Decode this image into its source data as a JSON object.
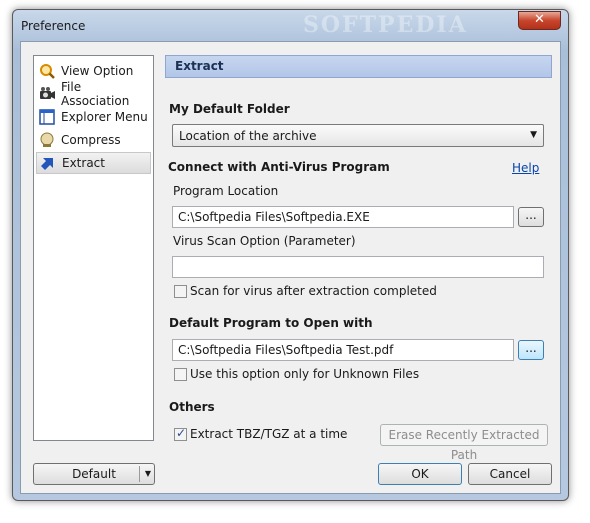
{
  "window": {
    "title": "Preference",
    "watermark": "SOFTPEDIA",
    "close_symbol": "✕"
  },
  "nav": {
    "items": [
      {
        "label": "View Option",
        "icon": "magnifier-icon"
      },
      {
        "label": "File Association",
        "icon": "camera-icon"
      },
      {
        "label": "Explorer Menu",
        "icon": "window-icon"
      },
      {
        "label": "Compress",
        "icon": "compress-icon"
      },
      {
        "label": "Extract",
        "icon": "extract-arrow-icon",
        "selected": true
      }
    ]
  },
  "panel": {
    "header": "Extract",
    "default_folder": {
      "label": "My Default Folder",
      "value": "Location of the archive"
    },
    "antivirus": {
      "label": "Connect with Anti-Virus Program",
      "help_link": "Help",
      "program_location_label": "Program Location",
      "program_location_value": "C:\\Softpedia Files\\Softpedia.EXE",
      "browse_label": "...",
      "scan_option_label": "Virus Scan Option (Parameter)",
      "scan_option_value": "",
      "scan_checkbox_label": "Scan for virus after extraction completed",
      "scan_checked": false
    },
    "open_with": {
      "label": "Default Program to Open with",
      "value": "C:\\Softpedia Files\\Softpedia Test.pdf",
      "browse_label": "...",
      "unknown_only_label": "Use this option only for Unknown Files",
      "unknown_only_checked": false
    },
    "others": {
      "label": "Others",
      "tbz_label": "Extract TBZ/TGZ at a time",
      "tbz_checked": true,
      "erase_button": "Erase Recently Extracted Path"
    }
  },
  "footer": {
    "default_button": "Default",
    "ok_button": "OK",
    "cancel_button": "Cancel"
  }
}
